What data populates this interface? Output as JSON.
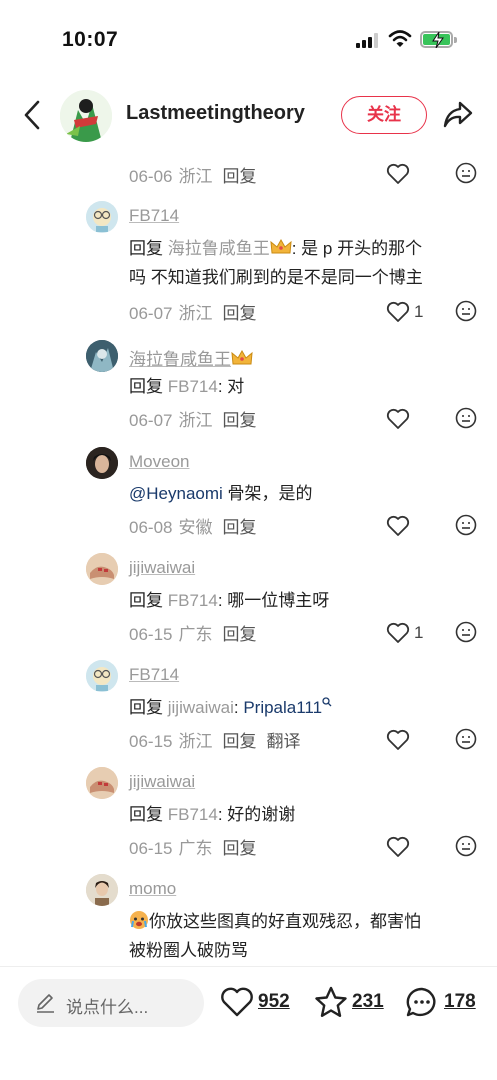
{
  "status_bar": {
    "time": "10:07"
  },
  "header": {
    "author": "Lastmeetingtheory",
    "follow_label": "关注"
  },
  "comments": [
    {
      "meta": {
        "date": "06-06",
        "location": "浙江",
        "reply": "回复"
      }
    },
    {
      "user": "FB714",
      "reply_prefix": "回复",
      "reply_to": "海拉鲁咸鱼王",
      "line1": ": 是 p 开头的那个",
      "line2": "吗 不知道我们刷到的是不是同一个博主",
      "meta": {
        "date": "06-07",
        "location": "浙江",
        "reply": "回复"
      },
      "likes": "1"
    },
    {
      "user": "海拉鲁咸鱼王",
      "reply_prefix": "回复",
      "reply_to": "FB714",
      "text": ": 对",
      "meta": {
        "date": "06-07",
        "location": "浙江",
        "reply": "回复"
      }
    },
    {
      "user": "Moveon",
      "mention": "@Heynaomi",
      "text": " 骨架，是的",
      "meta": {
        "date": "06-08",
        "location": "安徽",
        "reply": "回复"
      }
    },
    {
      "user": "jijiwaiwai",
      "reply_prefix": "回复",
      "reply_to": "FB714",
      "text": ": 哪一位博主呀",
      "meta": {
        "date": "06-15",
        "location": "广东",
        "reply": "回复"
      },
      "likes": "1"
    },
    {
      "user": "FB714",
      "reply_prefix": "回复",
      "reply_to": "jijiwaiwai",
      "colon": ": ",
      "link": "Pripala111",
      "meta": {
        "date": "06-15",
        "location": "浙江",
        "reply": "回复",
        "translate": "翻译"
      }
    },
    {
      "user": "jijiwaiwai",
      "reply_prefix": "回复",
      "reply_to": "FB714",
      "text": ": 好的谢谢",
      "meta": {
        "date": "06-15",
        "location": "广东",
        "reply": "回复"
      }
    },
    {
      "user": "momo",
      "line1": "你放这些图真的好直观残忍，都害怕",
      "line2": "被粉圈人破防骂"
    }
  ],
  "bottom_bar": {
    "placeholder": "说点什么...",
    "likes": "952",
    "favorites": "231",
    "comments": "178"
  },
  "colors": {
    "accent": "#e8334a",
    "link": "#1a3a6b",
    "meta_gray": "#999999"
  }
}
